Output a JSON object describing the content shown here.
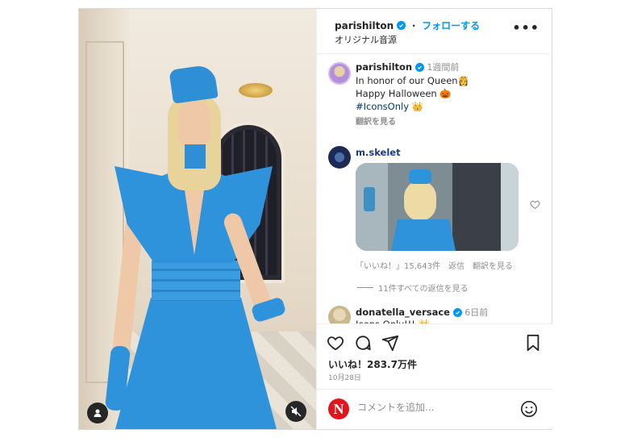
{
  "post": {
    "username": "parishilton",
    "follow_label": "フォローする",
    "separator": "・",
    "audio_label": "オリジナル音源",
    "more_label": "•••"
  },
  "caption": {
    "username": "parishilton",
    "time": "1週間前",
    "line1": "In honor of our Queen👸",
    "line2": "Happy Halloween 🎃",
    "hashtag": "#IconsOnly 👑",
    "translate": "翻訳を見る"
  },
  "comment1": {
    "username": "m.skelet",
    "likes": "「いいね！」15,643件",
    "reply": "返信",
    "translate": "翻訳を見る",
    "replies": "11件すべての返信を見る"
  },
  "comment2": {
    "username": "donatella_versace",
    "time": "6日前",
    "text": "Icons Only!!! 👑"
  },
  "stats": {
    "likes": "いいね！283.7万件",
    "date": "10月28日"
  },
  "composer": {
    "logo": "N",
    "placeholder": "コメントを追加..."
  },
  "colors": {
    "accent": "#0095f6",
    "brand": "#e0161b",
    "dress": "#2f93db"
  },
  "icons": [
    "user-tag-icon",
    "mute-icon",
    "more-icon",
    "verified-icon",
    "heart-icon",
    "comment-icon",
    "share-icon",
    "bookmark-icon",
    "emoji-icon"
  ]
}
